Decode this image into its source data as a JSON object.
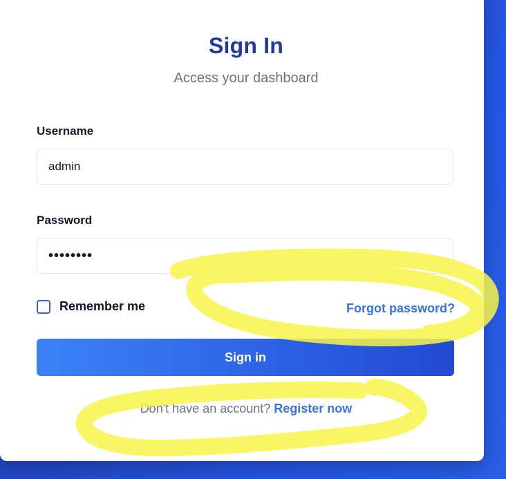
{
  "header": {
    "title": "Sign In",
    "subtitle": "Access your dashboard"
  },
  "form": {
    "username_label": "Username",
    "username_value": "admin",
    "password_label": "Password",
    "password_value": "••••••••",
    "remember_label": "Remember me",
    "remember_checked": false,
    "forgot_label": "Forgot password?",
    "submit_label": "Sign in"
  },
  "footer": {
    "prompt": "Don't have an account? ",
    "register_label": "Register now"
  },
  "colors": {
    "accent": "#3a72df",
    "title": "#1e3a9f",
    "highlight": "#f8f54a"
  }
}
